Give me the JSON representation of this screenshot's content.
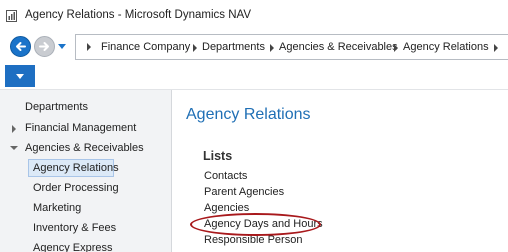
{
  "window": {
    "title": "Agency Relations - Microsoft Dynamics NAV"
  },
  "navigation": {
    "back_icon": "back-arrow-icon",
    "forward_icon": "forward-arrow-icon"
  },
  "breadcrumb": [
    "Finance Company",
    "Departments",
    "Agencies & Receivables",
    "Agency Relations"
  ],
  "nav_pane": {
    "items": [
      {
        "label": "Departments"
      },
      {
        "label": "Financial Management"
      },
      {
        "label": "Agencies & Receivables"
      },
      {
        "label": "Agency Relations",
        "selected": true
      },
      {
        "label": "Order Processing"
      },
      {
        "label": "Marketing"
      },
      {
        "label": "Inventory & Fees"
      },
      {
        "label": "Agency Express"
      }
    ]
  },
  "content": {
    "title": "Agency Relations",
    "lists_heading": "Lists",
    "links": [
      "Contacts",
      "Parent Agencies",
      "Agencies",
      "Agency Days and Hours",
      "Responsible Person"
    ],
    "highlighted_link": "Agency Days and Hours"
  },
  "colors": {
    "accent": "#1f6fb5",
    "nav_button": "#1a73c9",
    "highlight_ring": "#a8191c",
    "selection": "#dce9f7"
  }
}
